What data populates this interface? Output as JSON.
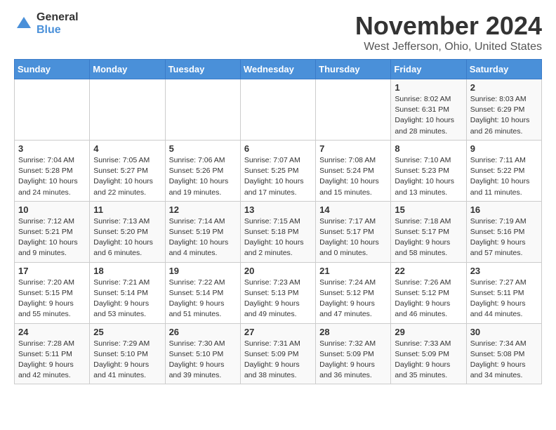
{
  "logo": {
    "general": "General",
    "blue": "Blue"
  },
  "header": {
    "month": "November 2024",
    "location": "West Jefferson, Ohio, United States"
  },
  "days_of_week": [
    "Sunday",
    "Monday",
    "Tuesday",
    "Wednesday",
    "Thursday",
    "Friday",
    "Saturday"
  ],
  "weeks": [
    [
      {
        "day": "",
        "info": ""
      },
      {
        "day": "",
        "info": ""
      },
      {
        "day": "",
        "info": ""
      },
      {
        "day": "",
        "info": ""
      },
      {
        "day": "",
        "info": ""
      },
      {
        "day": "1",
        "info": "Sunrise: 8:02 AM\nSunset: 6:31 PM\nDaylight: 10 hours and 28 minutes."
      },
      {
        "day": "2",
        "info": "Sunrise: 8:03 AM\nSunset: 6:29 PM\nDaylight: 10 hours and 26 minutes."
      }
    ],
    [
      {
        "day": "3",
        "info": "Sunrise: 7:04 AM\nSunset: 5:28 PM\nDaylight: 10 hours and 24 minutes."
      },
      {
        "day": "4",
        "info": "Sunrise: 7:05 AM\nSunset: 5:27 PM\nDaylight: 10 hours and 22 minutes."
      },
      {
        "day": "5",
        "info": "Sunrise: 7:06 AM\nSunset: 5:26 PM\nDaylight: 10 hours and 19 minutes."
      },
      {
        "day": "6",
        "info": "Sunrise: 7:07 AM\nSunset: 5:25 PM\nDaylight: 10 hours and 17 minutes."
      },
      {
        "day": "7",
        "info": "Sunrise: 7:08 AM\nSunset: 5:24 PM\nDaylight: 10 hours and 15 minutes."
      },
      {
        "day": "8",
        "info": "Sunrise: 7:10 AM\nSunset: 5:23 PM\nDaylight: 10 hours and 13 minutes."
      },
      {
        "day": "9",
        "info": "Sunrise: 7:11 AM\nSunset: 5:22 PM\nDaylight: 10 hours and 11 minutes."
      }
    ],
    [
      {
        "day": "10",
        "info": "Sunrise: 7:12 AM\nSunset: 5:21 PM\nDaylight: 10 hours and 9 minutes."
      },
      {
        "day": "11",
        "info": "Sunrise: 7:13 AM\nSunset: 5:20 PM\nDaylight: 10 hours and 6 minutes."
      },
      {
        "day": "12",
        "info": "Sunrise: 7:14 AM\nSunset: 5:19 PM\nDaylight: 10 hours and 4 minutes."
      },
      {
        "day": "13",
        "info": "Sunrise: 7:15 AM\nSunset: 5:18 PM\nDaylight: 10 hours and 2 minutes."
      },
      {
        "day": "14",
        "info": "Sunrise: 7:17 AM\nSunset: 5:17 PM\nDaylight: 10 hours and 0 minutes."
      },
      {
        "day": "15",
        "info": "Sunrise: 7:18 AM\nSunset: 5:17 PM\nDaylight: 9 hours and 58 minutes."
      },
      {
        "day": "16",
        "info": "Sunrise: 7:19 AM\nSunset: 5:16 PM\nDaylight: 9 hours and 57 minutes."
      }
    ],
    [
      {
        "day": "17",
        "info": "Sunrise: 7:20 AM\nSunset: 5:15 PM\nDaylight: 9 hours and 55 minutes."
      },
      {
        "day": "18",
        "info": "Sunrise: 7:21 AM\nSunset: 5:14 PM\nDaylight: 9 hours and 53 minutes."
      },
      {
        "day": "19",
        "info": "Sunrise: 7:22 AM\nSunset: 5:14 PM\nDaylight: 9 hours and 51 minutes."
      },
      {
        "day": "20",
        "info": "Sunrise: 7:23 AM\nSunset: 5:13 PM\nDaylight: 9 hours and 49 minutes."
      },
      {
        "day": "21",
        "info": "Sunrise: 7:24 AM\nSunset: 5:12 PM\nDaylight: 9 hours and 47 minutes."
      },
      {
        "day": "22",
        "info": "Sunrise: 7:26 AM\nSunset: 5:12 PM\nDaylight: 9 hours and 46 minutes."
      },
      {
        "day": "23",
        "info": "Sunrise: 7:27 AM\nSunset: 5:11 PM\nDaylight: 9 hours and 44 minutes."
      }
    ],
    [
      {
        "day": "24",
        "info": "Sunrise: 7:28 AM\nSunset: 5:11 PM\nDaylight: 9 hours and 42 minutes."
      },
      {
        "day": "25",
        "info": "Sunrise: 7:29 AM\nSunset: 5:10 PM\nDaylight: 9 hours and 41 minutes."
      },
      {
        "day": "26",
        "info": "Sunrise: 7:30 AM\nSunset: 5:10 PM\nDaylight: 9 hours and 39 minutes."
      },
      {
        "day": "27",
        "info": "Sunrise: 7:31 AM\nSunset: 5:09 PM\nDaylight: 9 hours and 38 minutes."
      },
      {
        "day": "28",
        "info": "Sunrise: 7:32 AM\nSunset: 5:09 PM\nDaylight: 9 hours and 36 minutes."
      },
      {
        "day": "29",
        "info": "Sunrise: 7:33 AM\nSunset: 5:09 PM\nDaylight: 9 hours and 35 minutes."
      },
      {
        "day": "30",
        "info": "Sunrise: 7:34 AM\nSunset: 5:08 PM\nDaylight: 9 hours and 34 minutes."
      }
    ]
  ]
}
